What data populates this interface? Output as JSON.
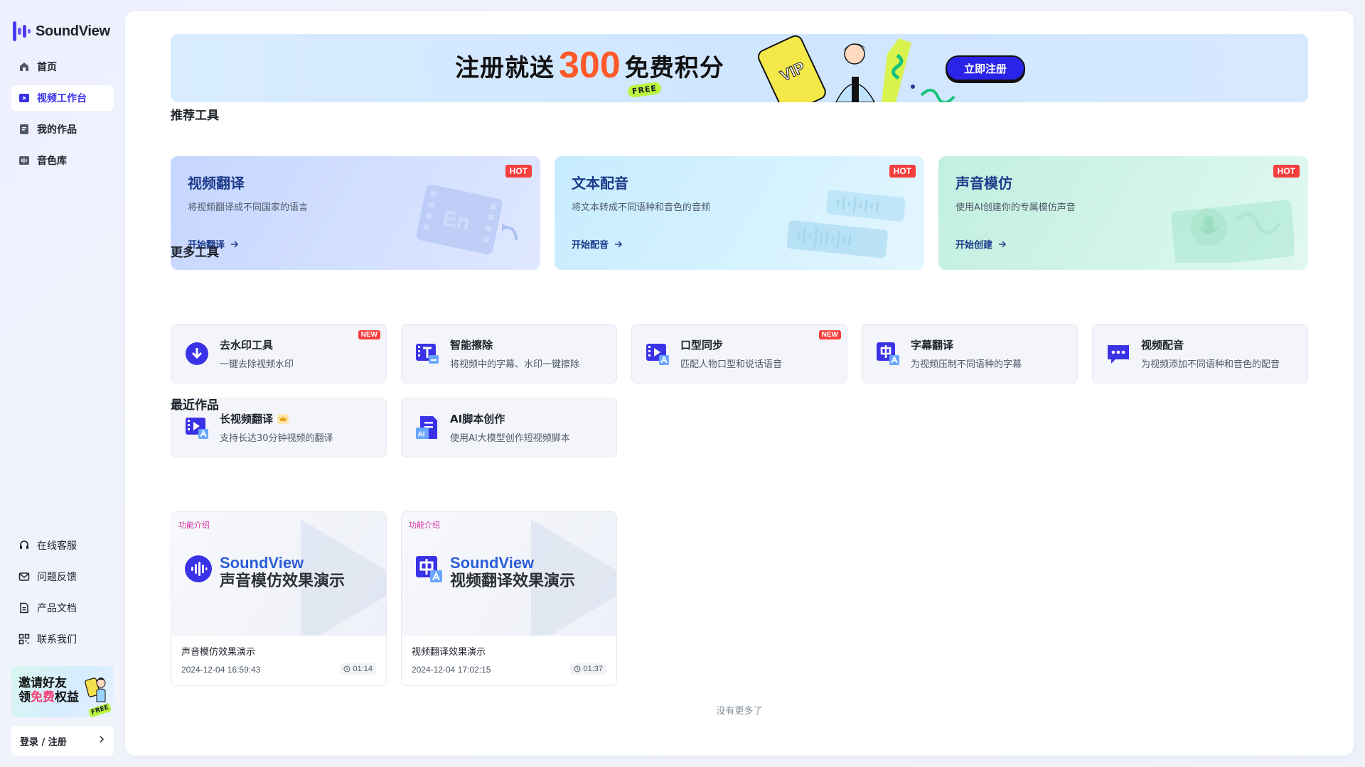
{
  "app": {
    "name": "SoundView",
    "brand_color": "#3a32e6"
  },
  "sidebar": {
    "items": [
      {
        "label": "首页",
        "icon": "home-icon",
        "active": false
      },
      {
        "label": "视频工作台",
        "icon": "video-workbench-icon",
        "active": true
      },
      {
        "label": "我的作品",
        "icon": "works-icon",
        "active": false
      },
      {
        "label": "音色库",
        "icon": "voice-library-icon",
        "active": false
      }
    ],
    "bottom_items": [
      {
        "label": "在线客服",
        "icon": "headset-icon"
      },
      {
        "label": "问题反馈",
        "icon": "mail-icon"
      },
      {
        "label": "产品文档",
        "icon": "document-icon"
      },
      {
        "label": "联系我们",
        "icon": "qr-code-icon"
      }
    ],
    "invite": {
      "line1": "邀请好友",
      "line2_pre": "领",
      "line2_hl": "免费",
      "line2_post": "权益",
      "badge": "FREE"
    },
    "login_label": "登录 / 注册"
  },
  "banner": {
    "text_a": "注册就送",
    "number": "300",
    "text_b": "免费积分",
    "free_badge": "FREE",
    "vip_label": "VIP",
    "cta": "立即注册"
  },
  "featured": {
    "title": "推荐工具",
    "cards": [
      {
        "title": "视频翻译",
        "desc": "将视频翻译成不同国家的语言",
        "link": "开始翻译",
        "badge": "HOT",
        "art_label": "En"
      },
      {
        "title": "文本配音",
        "desc": "将文本转成不同语种和音色的音频",
        "link": "开始配音",
        "badge": "HOT"
      },
      {
        "title": "声音模仿",
        "desc": "使用AI创建你的专属模仿声音",
        "link": "开始创建",
        "badge": "HOT"
      }
    ]
  },
  "more_tools": {
    "title": "更多工具",
    "items": [
      {
        "name": "去水印工具",
        "desc": "一键去除视频水印",
        "badge": "NEW",
        "icon": "watermark-remove-icon",
        "crown": false
      },
      {
        "name": "智能擦除",
        "desc": "将视频中的字幕、水印一键擦除",
        "badge": "",
        "icon": "smart-erase-icon",
        "crown": false
      },
      {
        "name": "口型同步",
        "desc": "匹配人物口型和说话语音",
        "badge": "NEW",
        "icon": "lip-sync-icon",
        "crown": false
      },
      {
        "name": "字幕翻译",
        "desc": "为视频压制不同语种的字幕",
        "badge": "",
        "icon": "subtitle-translate-icon",
        "crown": false
      },
      {
        "name": "视频配音",
        "desc": "为视频添加不同语种和音色的配音",
        "badge": "",
        "icon": "video-dubbing-icon",
        "crown": false
      },
      {
        "name": "长视频翻译",
        "desc": "支持长达30分钟视频的翻译",
        "badge": "",
        "icon": "long-video-translate-icon",
        "crown": true
      },
      {
        "name": "AI脚本创作",
        "desc": "使用AI大模型创作短视频脚本",
        "badge": "",
        "icon": "ai-script-icon",
        "crown": false
      }
    ]
  },
  "recent": {
    "title": "最近作品",
    "items": [
      {
        "tag": "功能介绍",
        "brand": "SoundView",
        "caption": "声音模仿效果演示",
        "title": "声音模仿效果演示",
        "date": "2024-12-04 16:59:43",
        "duration": "01:14",
        "logo": "voice-wave-logo-icon"
      },
      {
        "tag": "功能介绍",
        "brand": "SoundView",
        "caption": "视频翻译效果演示",
        "title": "视频翻译效果演示",
        "date": "2024-12-04 17:02:15",
        "duration": "01:37",
        "logo": "translate-logo-icon"
      }
    ],
    "end_text": "没有更多了"
  }
}
